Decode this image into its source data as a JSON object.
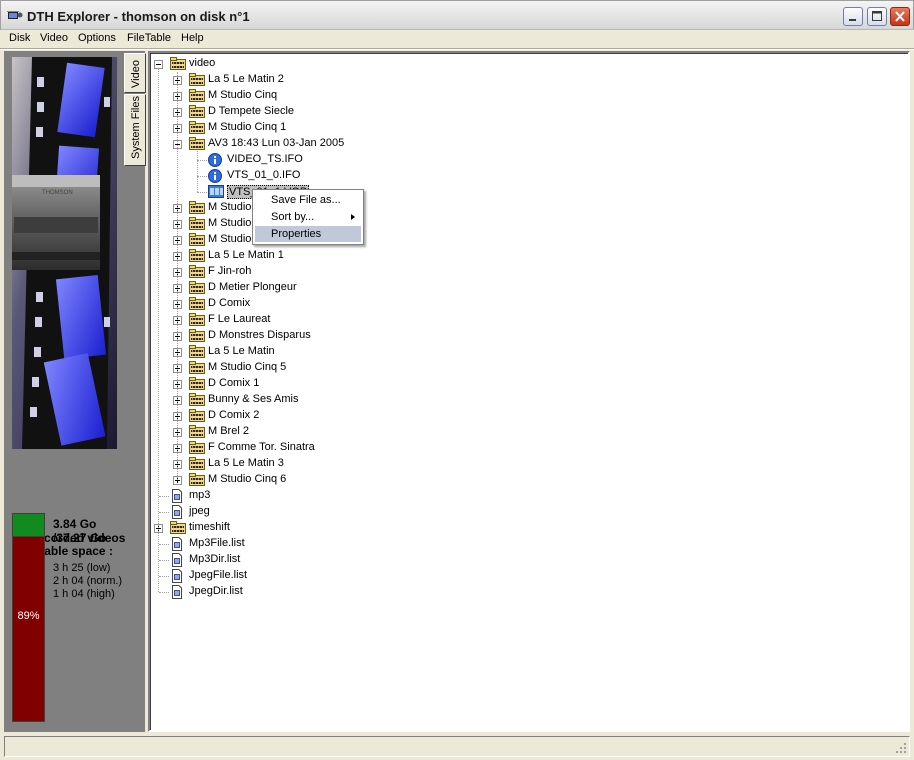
{
  "window": {
    "title": "DTH Explorer - thomson on disk n°1",
    "app_icon": "film-reel-icon",
    "buttons": [
      "minimize-icon",
      "maximize-icon",
      "close-icon"
    ]
  },
  "menubar": {
    "items": [
      "Disk",
      "Video",
      "Options",
      "FileTable",
      "Help"
    ]
  },
  "left_panel": {
    "tabs": [
      "Video",
      "System Files"
    ],
    "active_tab": "Video",
    "recorded_videos": "23 recorded videos",
    "available_space_label": "Available space :",
    "free_space": "3.84 Go",
    "total_space": "/37.27 Go",
    "used_percent_label": "89%",
    "used_fraction": 0.89,
    "durations": [
      "3 h 25 (low)",
      "2 h 04 (norm.)",
      "1 h 04 (high)"
    ],
    "colors": {
      "free": "#118a1f",
      "used": "#800000"
    }
  },
  "tree": {
    "root": "video",
    "video_children_before": [
      "La 5 Le Matin  2",
      "M Studio Cinq",
      "D Tempete Siecle",
      "M Studio Cinq  1"
    ],
    "expanded": {
      "label": "AV3 18:43 Lun 03-Jan 2005",
      "files": [
        "VIDEO_TS.IFO",
        "VTS_01_0.IFO",
        "VTS_01_1.VOB"
      ]
    },
    "video_children_after": [
      "M Studio Cinq  2",
      "M Studio Cinq  3",
      "M Studio Cinq  4",
      "La 5 Le Matin  1",
      "F Jin-roh",
      "D Metier Plongeur",
      "D Comix",
      "F Le Laureat",
      "D Monstres Disparus",
      "La 5 Le Matin",
      "M Studio Cinq  5",
      "D Comix  1",
      "Bunny & Ses Amis",
      "D Comix  2",
      "M Brel 2",
      "F Comme Tor. Sinatra",
      "La 5 Le Matin  3",
      "M Studio Cinq  6"
    ],
    "root_items": [
      "mp3",
      "jpeg",
      "timeshift",
      "Mp3File.list",
      "Mp3Dir.list",
      "JpegFile.list",
      "JpegDir.list"
    ]
  },
  "context_menu": {
    "items": [
      "Save File as...",
      "Sort by...",
      "Properties"
    ],
    "highlighted": "Properties"
  },
  "statusbar": {
    "text": ""
  }
}
